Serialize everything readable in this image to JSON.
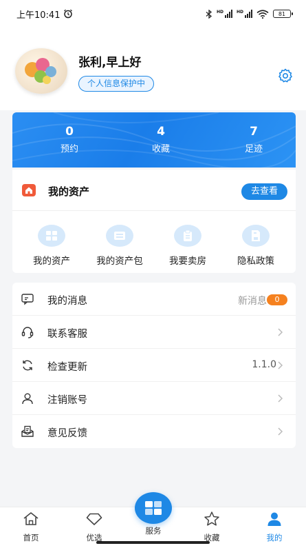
{
  "status_bar": {
    "time": "上午10:41",
    "battery": "81"
  },
  "profile": {
    "greeting": "张利,早上好",
    "privacy_badge": "个人信息保护中"
  },
  "stats": [
    {
      "value": "0",
      "label": "预约"
    },
    {
      "value": "4",
      "label": "收藏"
    },
    {
      "value": "7",
      "label": "足迹"
    }
  ],
  "assets": {
    "title": "我的资产",
    "view_button": "去查看",
    "items": [
      {
        "label": "我的资产",
        "icon": "grid-icon"
      },
      {
        "label": "我的资产包",
        "icon": "package-icon"
      },
      {
        "label": "我要卖房",
        "icon": "clipboard-icon"
      },
      {
        "label": "隐私政策",
        "icon": "document-icon"
      }
    ]
  },
  "menu": {
    "messages": {
      "label": "我的消息",
      "hint": "新消息",
      "count": "0"
    },
    "service": {
      "label": "联系客服"
    },
    "update": {
      "label": "检查更新",
      "value": "1.1.0"
    },
    "deregister": {
      "label": "注销账号"
    },
    "feedback": {
      "label": "意见反馈"
    }
  },
  "tabbar": {
    "home": "首页",
    "featured": "优选",
    "service": "服务",
    "favorites": "收藏",
    "mine": "我的"
  },
  "colors": {
    "accent": "#1e88e5",
    "badge_orange": "#f5811f",
    "asset_icon_red": "#f05a3a"
  }
}
